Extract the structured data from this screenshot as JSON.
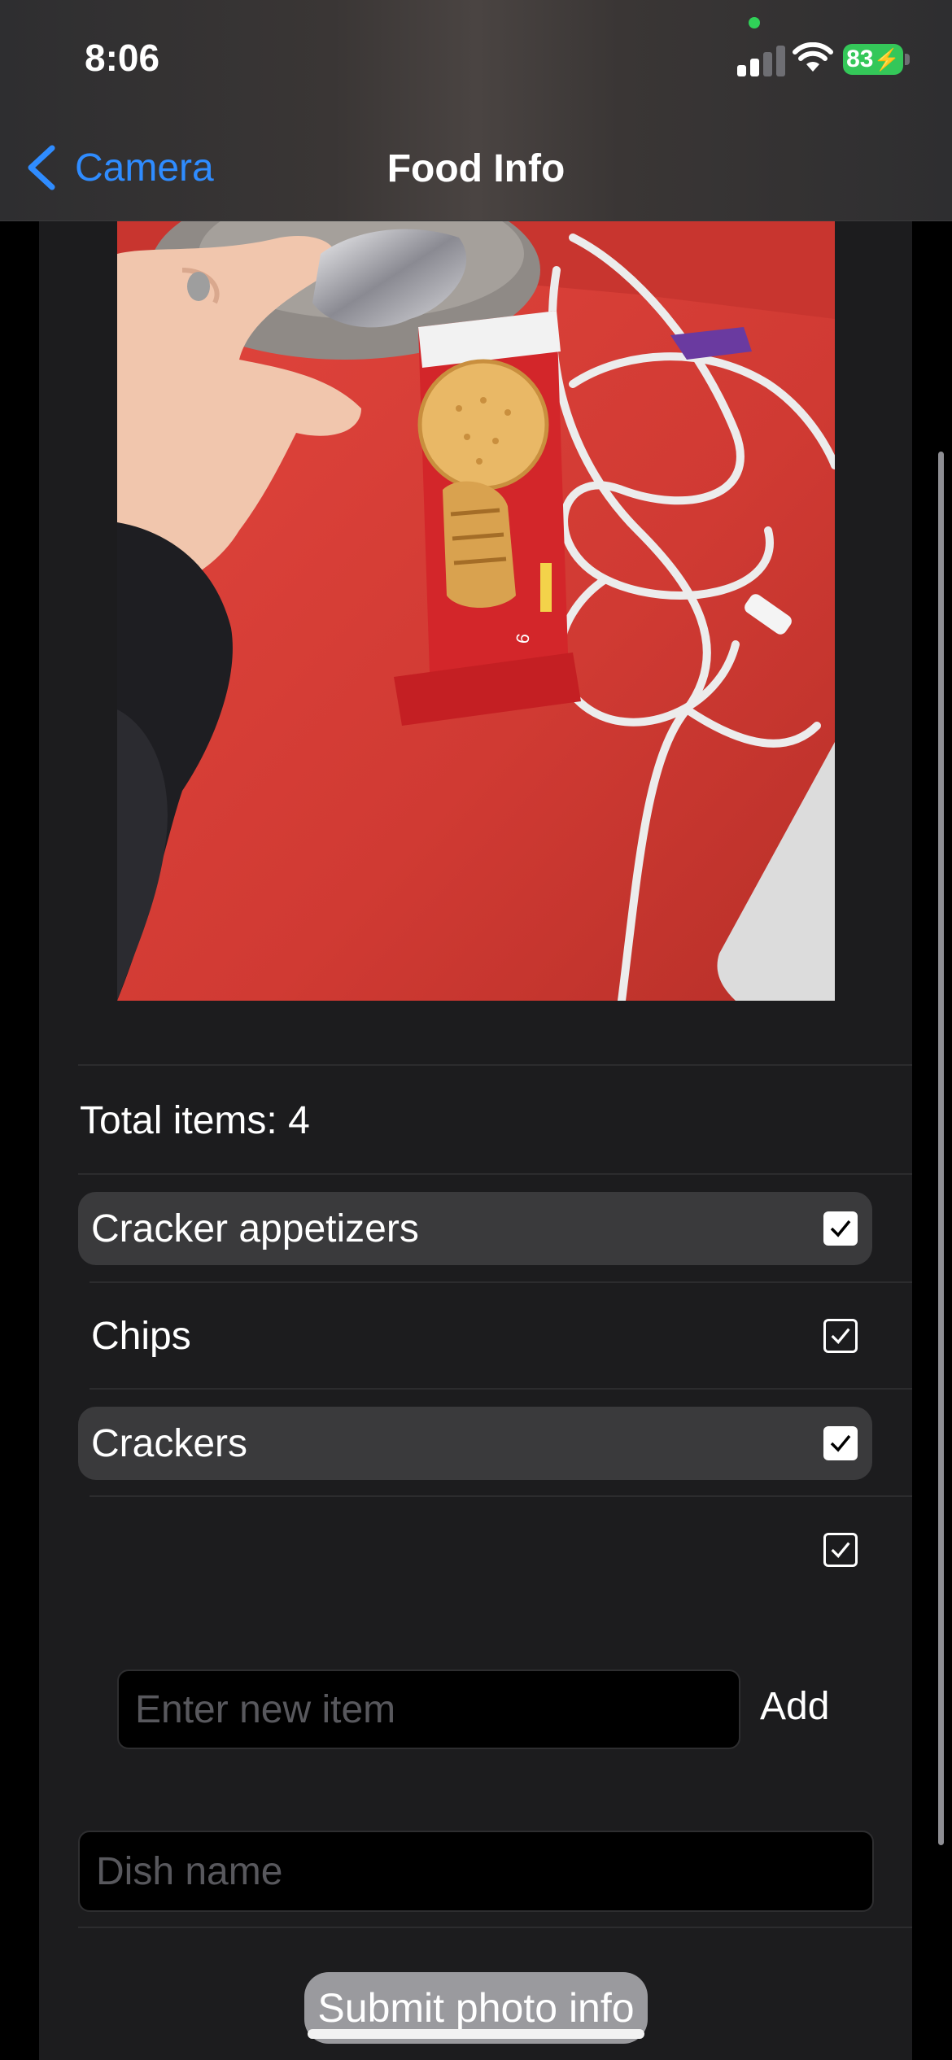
{
  "status_bar": {
    "time": "8:06",
    "battery": "83"
  },
  "nav": {
    "back_label": "Camera",
    "title": "Food Info"
  },
  "summary": {
    "total_items": "Total items: 4"
  },
  "items": [
    {
      "label": "Cracker appetizers",
      "checked": true,
      "highlighted": true
    },
    {
      "label": "Chips",
      "checked": true,
      "highlighted": false
    },
    {
      "label": "Crackers",
      "checked": true,
      "highlighted": true
    },
    {
      "label": "",
      "checked": true,
      "highlighted": false
    }
  ],
  "new_item": {
    "placeholder": "Enter new item",
    "value": "",
    "add_label": "Add"
  },
  "dish": {
    "placeholder": "Dish name",
    "value": ""
  },
  "submit_label": "Submit photo info",
  "colors": {
    "accent": "#2f8cff",
    "battery": "#34c759",
    "background": "#1c1c1e",
    "highlight": "#3a3a3c"
  },
  "icons": {
    "back": "chevron-left-icon",
    "signal": "signal-icon",
    "wifi": "wifi-icon",
    "battery": "battery-icon",
    "check": "checkbox-icon"
  }
}
